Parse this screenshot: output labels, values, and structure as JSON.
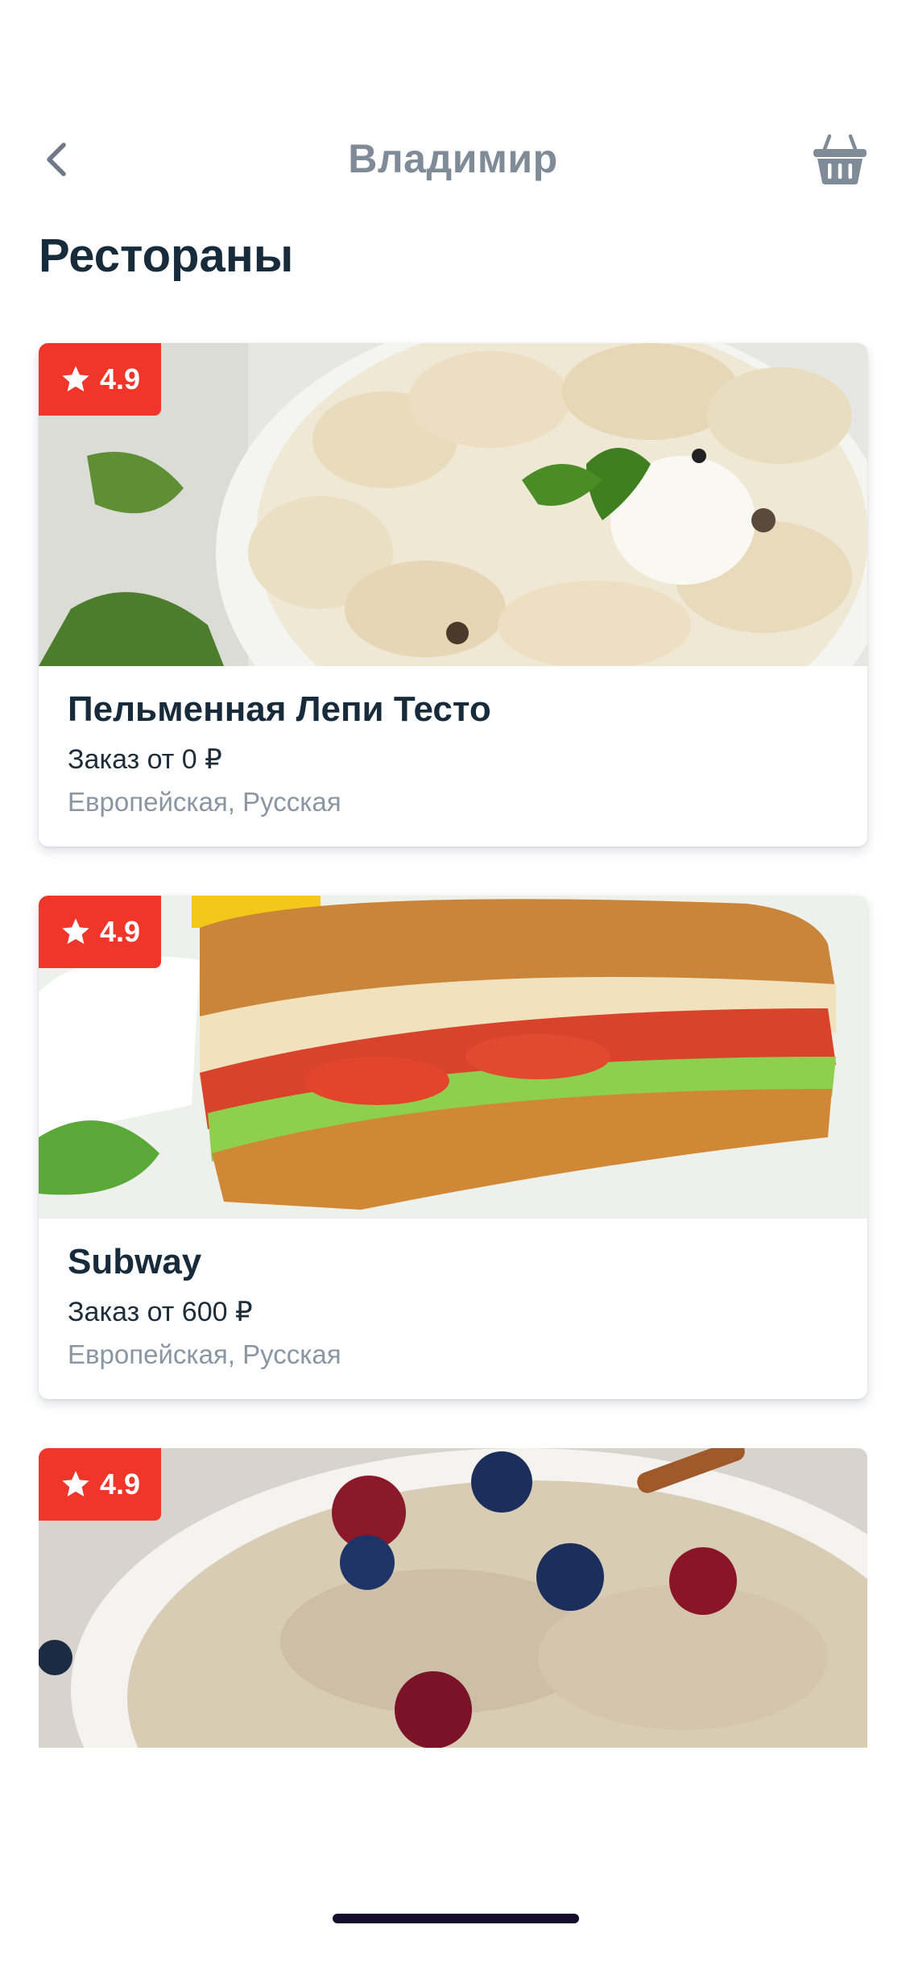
{
  "header": {
    "title": "Владимир",
    "back_icon": "chevron-left-icon",
    "basket_icon": "basket-icon"
  },
  "section": {
    "title": "Рестораны"
  },
  "restaurants": [
    {
      "rating": "4.9",
      "name": "Пельменная Лепи Тесто",
      "min_order": "Заказ от 0 ₽",
      "cuisine": "Европейская, Русская",
      "image": "dumplings-photo"
    },
    {
      "rating": "4.9",
      "name": "Subway",
      "min_order": "Заказ от 600 ₽",
      "cuisine": "Европейская, Русская",
      "image": "sandwich-photo"
    },
    {
      "rating": "4.9",
      "image": "oatmeal-photo"
    }
  ],
  "colors": {
    "accent_red": "#f0352b",
    "title_dark": "#172b3a",
    "muted_gray": "#7f8b97"
  }
}
